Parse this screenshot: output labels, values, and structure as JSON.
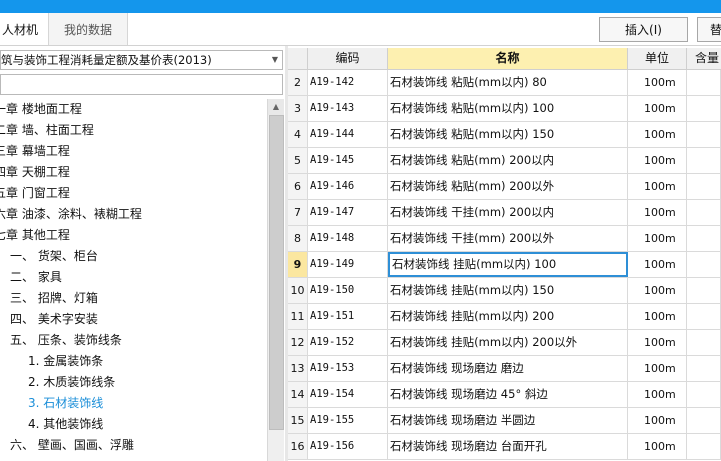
{
  "toolbar": {
    "tabs": [
      "人材机",
      "我的数据"
    ],
    "insert_button": "插入(I)",
    "replace_button": "替"
  },
  "library_selector": {
    "value": "筑与装饰工程消耗量定额及基价表(2013)"
  },
  "tree": [
    {
      "label": "一章 楼地面工程",
      "level": 0
    },
    {
      "label": "二章 墙、柱面工程",
      "level": 0
    },
    {
      "label": "三章 幕墙工程",
      "level": 0
    },
    {
      "label": "四章 天棚工程",
      "level": 0
    },
    {
      "label": "五章 门窗工程",
      "level": 0
    },
    {
      "label": "六章 油漆、涂料、裱糊工程",
      "level": 0
    },
    {
      "label": "七章 其他工程",
      "level": 0
    },
    {
      "label": "一、 货架、柜台",
      "level": 1
    },
    {
      "label": "二、 家具",
      "level": 1
    },
    {
      "label": "三、 招牌、灯箱",
      "level": 1
    },
    {
      "label": "四、 美术字安装",
      "level": 1
    },
    {
      "label": "五、 压条、装饰线条",
      "level": 1
    },
    {
      "label": "1. 金属装饰条",
      "level": 2
    },
    {
      "label": "2. 木质装饰线条",
      "level": 2
    },
    {
      "label": "3. 石材装饰线",
      "level": 2,
      "selected": true
    },
    {
      "label": "4. 其他装饰线",
      "level": 2
    },
    {
      "label": "六、 壁画、国画、浮雕",
      "level": 1
    }
  ],
  "grid": {
    "columns": [
      "",
      "编码",
      "名称",
      "单位",
      "含量"
    ],
    "active_row": "9",
    "rows": [
      {
        "num": "2",
        "code": "A19-142",
        "name": "石材装饰线 粘贴(mm以内) 80",
        "unit": "100m"
      },
      {
        "num": "3",
        "code": "A19-143",
        "name": "石材装饰线 粘贴(mm以内) 100",
        "unit": "100m"
      },
      {
        "num": "4",
        "code": "A19-144",
        "name": "石材装饰线 粘贴(mm以内) 150",
        "unit": "100m"
      },
      {
        "num": "5",
        "code": "A19-145",
        "name": "石材装饰线 粘贴(mm) 200以内",
        "unit": "100m"
      },
      {
        "num": "6",
        "code": "A19-146",
        "name": "石材装饰线 粘贴(mm) 200以外",
        "unit": "100m"
      },
      {
        "num": "7",
        "code": "A19-147",
        "name": "石材装饰线 干挂(mm) 200以内",
        "unit": "100m"
      },
      {
        "num": "8",
        "code": "A19-148",
        "name": "石材装饰线 干挂(mm) 200以外",
        "unit": "100m"
      },
      {
        "num": "9",
        "code": "A19-149",
        "name": "石材装饰线 挂贴(mm以内) 100",
        "unit": "100m"
      },
      {
        "num": "10",
        "code": "A19-150",
        "name": "石材装饰线 挂贴(mm以内) 150",
        "unit": "100m"
      },
      {
        "num": "11",
        "code": "A19-151",
        "name": "石材装饰线 挂贴(mm以内) 200",
        "unit": "100m"
      },
      {
        "num": "12",
        "code": "A19-152",
        "name": "石材装饰线 挂贴(mm以内) 200以外",
        "unit": "100m"
      },
      {
        "num": "13",
        "code": "A19-153",
        "name": "石材装饰线 现场磨边 磨边",
        "unit": "100m"
      },
      {
        "num": "14",
        "code": "A19-154",
        "name": "石材装饰线 现场磨边 45° 斜边",
        "unit": "100m"
      },
      {
        "num": "15",
        "code": "A19-155",
        "name": "石材装饰线 现场磨边 半圆边",
        "unit": "100m"
      },
      {
        "num": "16",
        "code": "A19-156",
        "name": "石材装饰线 现场磨边 台面开孔",
        "unit": "100m"
      }
    ]
  }
}
